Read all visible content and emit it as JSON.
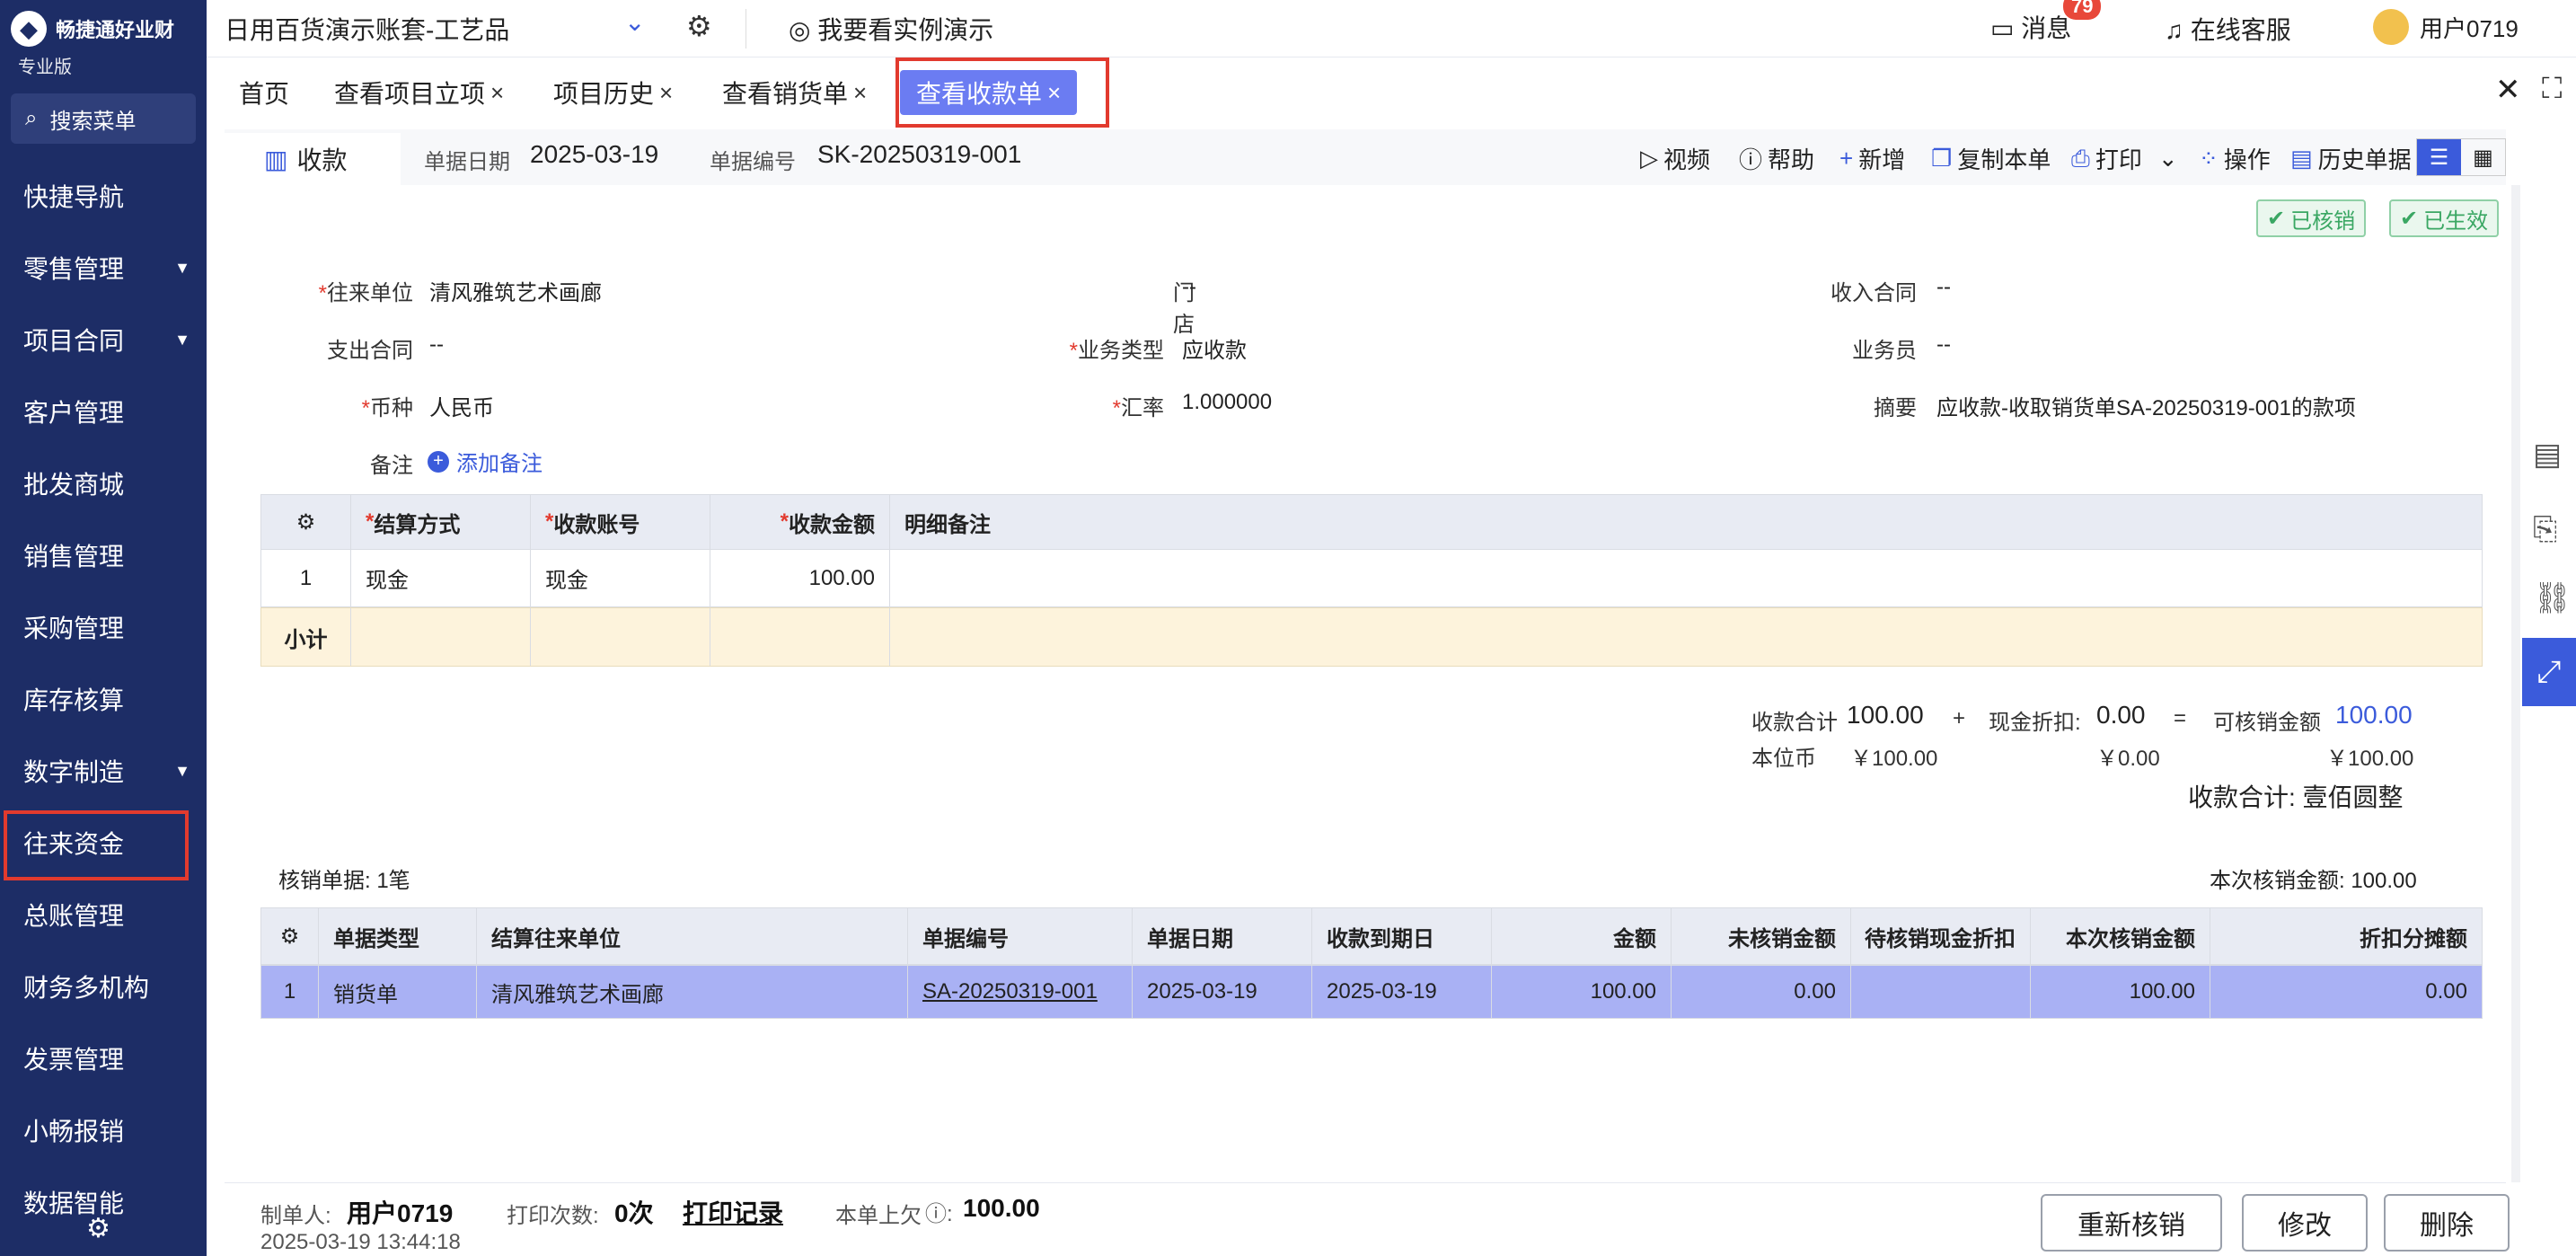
{
  "sidebar": {
    "brand": "畅捷通好业财",
    "edition": "专业版",
    "search": "搜索菜单",
    "items": [
      {
        "label": "快捷导航",
        "caret": false
      },
      {
        "label": "零售管理",
        "caret": true
      },
      {
        "label": "项目合同",
        "caret": true
      },
      {
        "label": "客户管理",
        "caret": false
      },
      {
        "label": "批发商城",
        "caret": false
      },
      {
        "label": "销售管理",
        "caret": false
      },
      {
        "label": "采购管理",
        "caret": false
      },
      {
        "label": "库存核算",
        "caret": false
      },
      {
        "label": "数字制造",
        "caret": true
      },
      {
        "label": "往来资金",
        "caret": false
      },
      {
        "label": "总账管理",
        "caret": false
      },
      {
        "label": "财务多机构",
        "caret": false
      },
      {
        "label": "发票管理",
        "caret": false
      },
      {
        "label": "小畅报销",
        "caret": false
      },
      {
        "label": "数据智能",
        "caret": false
      }
    ],
    "active_item": "往来资金"
  },
  "topbar": {
    "account": "日用百货演示账套-工艺品",
    "demo": "我要看实例演示",
    "messages": "消息",
    "message_count": "79",
    "service": "在线客服",
    "user": "用户0719"
  },
  "tabs": [
    {
      "label": "首页",
      "closable": false
    },
    {
      "label": "查看项目立项",
      "closable": true
    },
    {
      "label": "项目历史",
      "closable": true
    },
    {
      "label": "查看销货单",
      "closable": true
    },
    {
      "label": "查看收款单",
      "closable": true,
      "active": true
    }
  ],
  "doc": {
    "type_tab": "收款",
    "date_label": "单据日期",
    "date": "2025-03-19",
    "no_label": "单据编号",
    "no": "SK-20250319-001",
    "toolbar": {
      "video": "视频",
      "help": "帮助",
      "new": "新增",
      "copy": "复制本单",
      "print": "打印",
      "ops": "操作",
      "history": "历史单据"
    },
    "badges": [
      "已核销",
      "已生效"
    ],
    "fields": {
      "partner_label": "往来单位",
      "partner": "清风雅筑艺术画廊",
      "store_label": "门店",
      "store": "--",
      "income_contract_label": "收入合同",
      "income_contract": "--",
      "expense_contract_label": "支出合同",
      "expense_contract": "--",
      "biz_type_label": "业务类型",
      "biz_type": "应收款",
      "salesman_label": "业务员",
      "salesman": "--",
      "currency_label": "币种",
      "currency": "人民币",
      "rate_label": "汇率",
      "rate": "1.000000",
      "summary_label": "摘要",
      "summary": "应收款-收取销货单SA-20250319-001的款项",
      "note_label": "备注",
      "add_note": "添加备注"
    }
  },
  "detail_table": {
    "headers": [
      "结算方式",
      "收款账号",
      "收款金额",
      "明细备注"
    ],
    "rows": [
      {
        "no": "1",
        "method": "现金",
        "account": "现金",
        "amount": "100.00",
        "note": ""
      }
    ],
    "subtotal_label": "小计"
  },
  "totals": {
    "receipt_label": "收款合计",
    "receipt": "100.00",
    "plus": "+",
    "discount_label": "现金折扣:",
    "discount": "0.00",
    "equals": "=",
    "writeoff_label": "可核销金额",
    "writeoff": "100.00",
    "base_currency_label": "本位币",
    "base_receipt": "￥100.00",
    "base_discount": "￥0.00",
    "base_writeoff": "￥100.00",
    "chinese_total": "收款合计: 壹佰圆整"
  },
  "verify": {
    "count": "核销单据: 1笔",
    "amount": "本次核销金额: 100.00",
    "headers": [
      "单据类型",
      "结算往来单位",
      "单据编号",
      "单据日期",
      "收款到期日",
      "金额",
      "未核销金额",
      "待核销现金折扣",
      "本次核销金额",
      "折扣分摊额"
    ],
    "rows": [
      {
        "no": "1",
        "type": "销货单",
        "partner": "清风雅筑艺术画廊",
        "doc_no": "SA-20250319-001",
        "date": "2025-03-19",
        "due": "2025-03-19",
        "amount": "100.00",
        "unverified": "0.00",
        "pending_discount": "",
        "this_verify": "100.00",
        "discount_share": "0.00"
      }
    ]
  },
  "footer": {
    "maker_label": "制单人:",
    "maker": "用户0719",
    "made_at": "2025-03-19 13:44:18",
    "print_count_label": "打印次数:",
    "print_count": "0次",
    "print_log": "打印记录",
    "owed_label": "本单上欠",
    "owed": "100.00",
    "buttons": [
      "重新核销",
      "修改",
      "删除"
    ]
  },
  "colors": {
    "sidebar_bg": "#1d2d66",
    "accent": "#3b5bdb",
    "active_tab": "#6b7cf2",
    "highlight_box": "#e23a2e",
    "selected_row": "#a9b1f4",
    "subtotal_bg": "#fdf3dc"
  }
}
